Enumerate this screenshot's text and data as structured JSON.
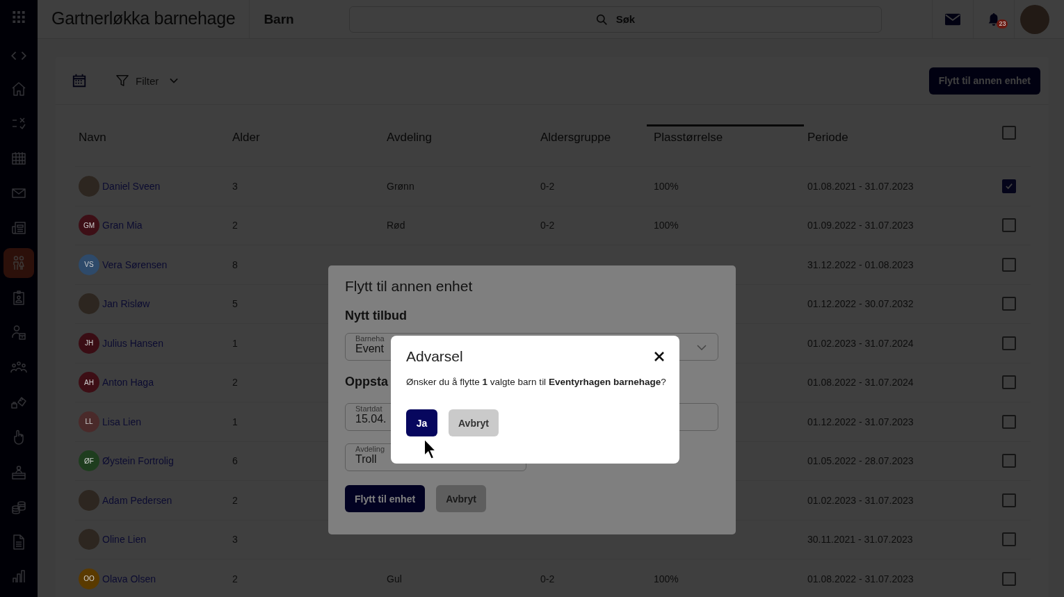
{
  "app": {
    "title": "Gartnerløkka barnehage",
    "section": "Barn"
  },
  "search": {
    "placeholder": "Søk"
  },
  "notifications": {
    "badge": "23"
  },
  "sidebar": {
    "items": [
      {
        "selected": false
      },
      {
        "selected": false
      },
      {
        "selected": false
      },
      {
        "selected": false
      },
      {
        "selected": false
      },
      {
        "selected": true
      },
      {
        "selected": false
      },
      {
        "selected": false
      },
      {
        "selected": false
      },
      {
        "selected": false
      },
      {
        "selected": false
      },
      {
        "selected": false
      },
      {
        "selected": false
      },
      {
        "selected": false
      },
      {
        "selected": false
      }
    ]
  },
  "toolbar": {
    "filter_label": "Filter",
    "move_button": "Flytt til annen enhet"
  },
  "table": {
    "columns": [
      {
        "label": "Navn",
        "sorted": false
      },
      {
        "label": "Alder",
        "sorted": false
      },
      {
        "label": "Avdeling",
        "sorted": false
      },
      {
        "label": "Aldersgruppe",
        "sorted": false
      },
      {
        "label": "Plasstørrelse",
        "sorted": true
      },
      {
        "label": "Periode",
        "sorted": false
      }
    ],
    "select_all": false,
    "rows": [
      {
        "name": "Daniel Sveen",
        "avatar": {
          "kind": "photo"
        },
        "age": "3",
        "department": "Grønn",
        "age_group": "0-2",
        "place_size": "100%",
        "period": "01.08.2021 - 31.07.2023",
        "checked": true
      },
      {
        "name": "Gran Mia",
        "avatar": {
          "kind": "initials",
          "initials": "GM",
          "color": "#3d0f16"
        },
        "age": "2",
        "department": "Rød",
        "age_group": "0-2",
        "place_size": "100%",
        "period": "01.09.2022 - 31.07.2023",
        "checked": false
      },
      {
        "name": "Vera Sørensen",
        "avatar": {
          "kind": "initials",
          "initials": "VS",
          "color": "#2e4a6a"
        },
        "age": "8",
        "period": "31.12.2022 - 01.08.2023",
        "checked": false
      },
      {
        "name": "Jan Risløw",
        "avatar": {
          "kind": "photo"
        },
        "age": "5",
        "period": "01.12.2022 - 30.07.2032",
        "checked": false
      },
      {
        "name": "Julius Hansen",
        "avatar": {
          "kind": "initials",
          "initials": "JH",
          "color": "#3a0d14"
        },
        "age": "1",
        "period": "01.02.2023 - 31.07.2024",
        "checked": false
      },
      {
        "name": "Anton Haga",
        "avatar": {
          "kind": "initials",
          "initials": "AH",
          "color": "#3d0e15"
        },
        "age": "2",
        "period": "01.08.2022 - 31.07.2024",
        "checked": false
      },
      {
        "name": "Lisa Lien",
        "avatar": {
          "kind": "initials",
          "initials": "LL",
          "color": "#4a2a2a"
        },
        "age": "1",
        "period": "01.12.2022 - 31.07.2023",
        "checked": false
      },
      {
        "name": "Øystein Fortrolig",
        "avatar": {
          "kind": "initials",
          "initials": "ØF",
          "color": "#1e3d1e"
        },
        "age": "6",
        "period": "01.05.2022 - 28.07.2023",
        "checked": false
      },
      {
        "name": "Adam Pedersen",
        "avatar": {
          "kind": "photo"
        },
        "age": "2",
        "period": "01.02.2023 - 31.07.2023",
        "checked": false
      },
      {
        "name": "Oline Lien",
        "avatar": {
          "kind": "photo"
        },
        "age": "3",
        "period": "30.11.2021 - 31.07.2023",
        "checked": false
      },
      {
        "name": "Olava Olsen",
        "avatar": {
          "kind": "initials",
          "initials": "OO",
          "color": "#5a3a00"
        },
        "age": "2",
        "department": "Gul",
        "age_group": "0-2",
        "place_size": "100%",
        "period": "01.08.2022 - 31.07.2023",
        "checked": false
      }
    ]
  },
  "move_dialog": {
    "title": "Flytt til annen enhet",
    "sections": [
      {
        "heading": "Nytt tilbud",
        "fields": [
          {
            "kind": "select",
            "label": "Barneha",
            "value": "Event"
          }
        ]
      },
      {
        "heading": "Oppsta",
        "fields": [
          {
            "kind": "text",
            "label": "Startdat",
            "value": "15.04."
          },
          {
            "kind": "select",
            "label": "Avdeling",
            "value": "Troll"
          }
        ]
      }
    ],
    "confirm_button": "Flytt til enhet",
    "cancel_button": "Avbryt"
  },
  "warning": {
    "title": "Advarsel",
    "message": "Ønsker du å flytte **1** valgte barn til **Eventyrhagen barnehage**?",
    "confirm_button": "Ja",
    "cancel_button": "Avbryt"
  }
}
